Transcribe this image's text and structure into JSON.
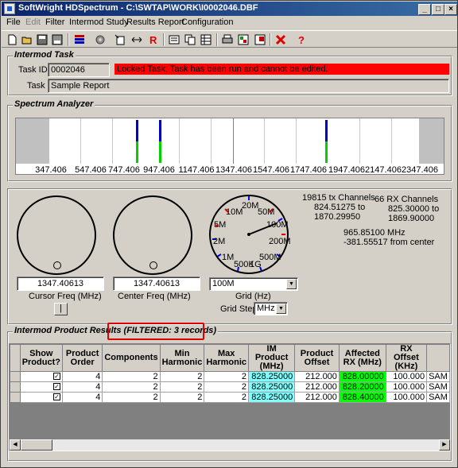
{
  "window": {
    "title": "SoftWright HDSpectrum - C:\\SWTAP\\WORK\\I0002046.DBF"
  },
  "menu": [
    "File",
    "Edit",
    "Filter",
    "Intermod Study",
    "Results Report",
    "Configuration"
  ],
  "toolbar_icons": [
    "new-icon",
    "open-icon",
    "save-icon",
    "disk-icon",
    "list-icon",
    "settings-icon",
    "import-icon",
    "range-icon",
    "run-icon",
    "report-icon",
    "copy-icon",
    "table-icon",
    "print-icon",
    "export-icon",
    "export-table-icon",
    "close-icon",
    "help-icon"
  ],
  "task": {
    "group_title": "Intermod Task",
    "id_label": "Task ID:",
    "id_value": "0002046",
    "lock_message": "Locked Task; Task has been run and cannot be edited.",
    "task_label": "Task",
    "task_value": "Sample Report"
  },
  "spectrum": {
    "group_title": "Spectrum Analyzer",
    "ticks": [
      "347.406",
      "547.406",
      "747.406",
      "947.406",
      "1147.406",
      "1347.406",
      "1547.406",
      "1747.406",
      "1947.406",
      "2147.406",
      "2347.406"
    ]
  },
  "controls": {
    "cursor_freq": "1347.40613",
    "cursor_label": "Cursor Freq (MHz)",
    "center_freq": "1347.40613",
    "center_label": "Center Freq (MHz)",
    "grid_value": "100M",
    "grid_label": "Grid (Hz)",
    "grid_step_label": "Grid Step",
    "grid_step_value": "MHz",
    "dial_labels": [
      "10M",
      "20M",
      "50M",
      "100M",
      "200M",
      "500M",
      "1G",
      "500K",
      "1M",
      "2M",
      "5M"
    ],
    "tx_channels": "19815 tx Channels",
    "tx_from": "824.51275 to",
    "tx_to": "1870.29950",
    "rx_channels": "66 RX Channels",
    "rx_from": "825.30000 to",
    "rx_to": "1869.90000",
    "cursor_mhz": "965.85100 MHz",
    "from_center": "-381.55517 from center",
    "button_label": "|"
  },
  "results": {
    "group_title": "Intermod Product Results",
    "filter_note": "(FILTERED: 3 records)",
    "columns": [
      "Show Product?",
      "Product Order",
      "Components",
      "Min Harmonic",
      "Max Harmonic",
      "IM Product (MHz)",
      "Product Offset",
      "Affected RX (MHz)",
      "RX Offset (KHz)",
      ""
    ],
    "rows": [
      {
        "show": "✓",
        "order": "4",
        "components": "2",
        "min": "2",
        "max": "2",
        "im": "828.25000",
        "offset": "212.000",
        "rx": "828.00000",
        "rxoff": "100.000",
        "extra": "SAM"
      },
      {
        "show": "✓",
        "order": "4",
        "components": "2",
        "min": "2",
        "max": "2",
        "im": "828.25000",
        "offset": "212.000",
        "rx": "828.20000",
        "rxoff": "100.000",
        "extra": "SAM"
      },
      {
        "show": "✓",
        "order": "4",
        "components": "2",
        "min": "2",
        "max": "2",
        "im": "828.25000",
        "offset": "212.000",
        "rx": "828.40000",
        "rxoff": "100.000",
        "extra": "SAM"
      }
    ]
  },
  "colors": {
    "titlebar": "#0a246a",
    "alert": "#ff0000",
    "im_cell": "#7fffff",
    "rx_cell": "#00ff00",
    "marker_blue": "#0000c0",
    "marker_green": "#00d000"
  }
}
